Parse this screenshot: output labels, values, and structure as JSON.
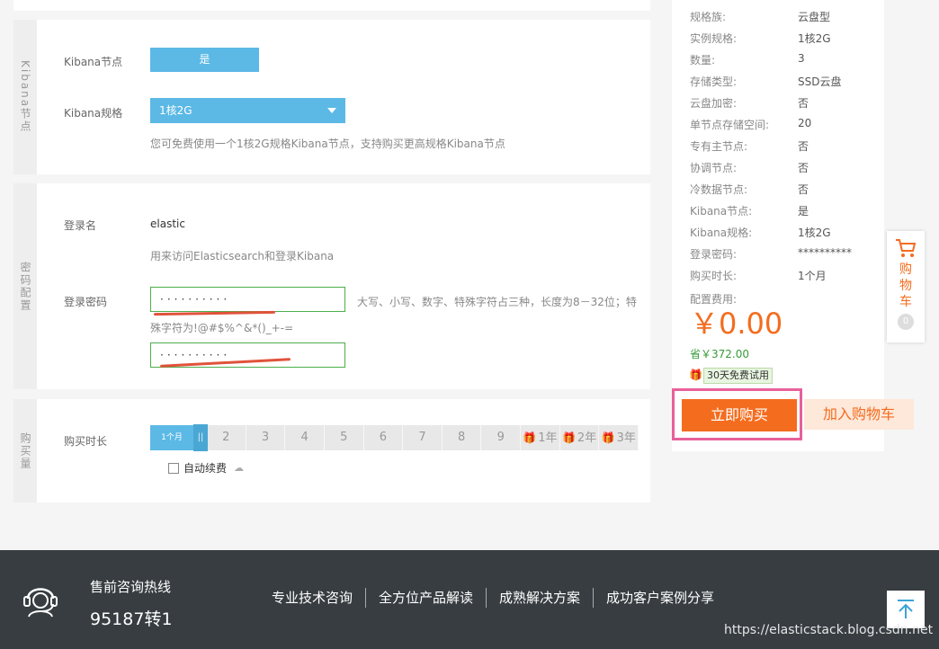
{
  "kibana": {
    "section_label": "Kibana节点",
    "node_label": "Kibana节点",
    "node_value": "是",
    "spec_label": "Kibana规格",
    "spec_value": "1核2G",
    "hint": "您可免费使用一个1核2G规格Kibana节点，支持购买更高规格Kibana节点"
  },
  "password": {
    "section_label": "密码配置",
    "login_label": "登录名",
    "login_value": "elastic",
    "login_hint": "用来访问Elasticsearch和登录Kibana",
    "pwd_label": "登录密码",
    "pwd_masked": "··········",
    "pwd_confirm_masked": "··········",
    "pwd_rule_line1": "大写、小写、数字、特殊字符占三种，长度为8－32位；特",
    "pwd_rule_line2": "殊字符为!@#$%^&*()_+-="
  },
  "duration": {
    "section_label": "购买量",
    "label": "购买时长",
    "options": [
      "1个月",
      "2",
      "3",
      "4",
      "5",
      "6",
      "7",
      "8",
      "9",
      "1年",
      "2年",
      "3年"
    ],
    "handle": "||",
    "auto_renew": "自动续费"
  },
  "summary": {
    "rows": [
      {
        "k": "规格族:",
        "v": "云盘型"
      },
      {
        "k": "实例规格:",
        "v": "1核2G"
      },
      {
        "k": "数量:",
        "v": "3"
      },
      {
        "k": "存储类型:",
        "v": "SSD云盘"
      },
      {
        "k": "云盘加密:",
        "v": "否"
      },
      {
        "k": "单节点存储空间:",
        "v": "20"
      },
      {
        "k": "专有主节点:",
        "v": "否"
      },
      {
        "k": "协调节点:",
        "v": "否"
      },
      {
        "k": "冷数据节点:",
        "v": "否"
      },
      {
        "k": "Kibana节点:",
        "v": "是"
      },
      {
        "k": "Kibana规格:",
        "v": "1核2G"
      },
      {
        "k": "登录密码:",
        "v": "**********"
      },
      {
        "k": "购买时长:",
        "v": "1个月"
      }
    ],
    "fee_label": "配置费用:",
    "price": "￥0.00",
    "save": "省￥372.00",
    "trial": "30天免费试用",
    "buy_now": "立即购买",
    "add_cart": "加入购物车"
  },
  "cart_float": {
    "label": "购物车",
    "count": "0"
  },
  "footer": {
    "hotline_label": "售前咨询热线",
    "hotline_number": "95187转1",
    "links": [
      "专业技术咨询",
      "全方位产品解读",
      "成熟解决方案",
      "成功客户案例分享"
    ],
    "watermark": "https://elasticstack.blog.csdn.net"
  },
  "colors": {
    "accent_blue": "#5cb9e6",
    "orange": "#f46c1e",
    "green_border": "#4cae4c",
    "footer_bg": "#373d41",
    "highlight_pink": "#e8609a"
  }
}
